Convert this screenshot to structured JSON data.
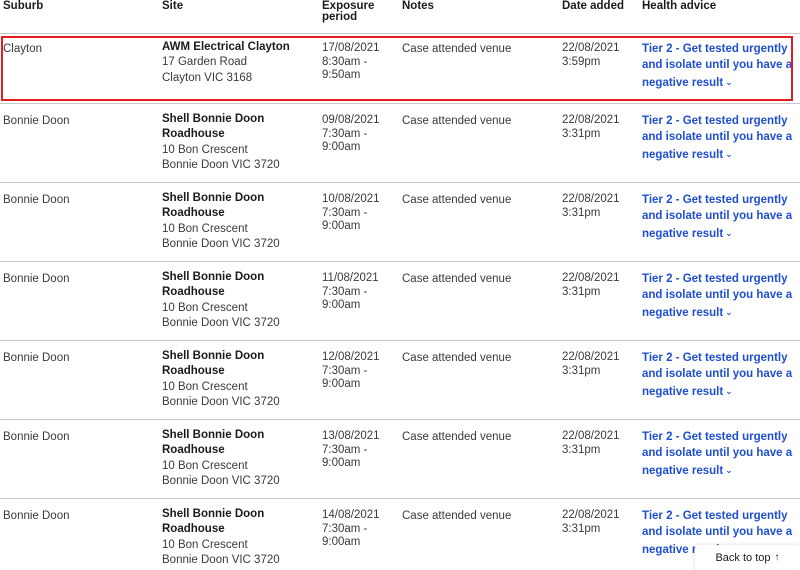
{
  "headers": {
    "suburb": "Suburb",
    "site": "Site",
    "exposure_line1": "Exposure",
    "exposure_line2": "period",
    "notes": "Notes",
    "date_added": "Date added",
    "health_advice": "Health advice"
  },
  "rows": [
    {
      "suburb": "Clayton",
      "site_name": "AWM Electrical Clayton",
      "address1": "17 Garden Road",
      "address2": "Clayton VIC 3168",
      "exp_date": "17/08/2021",
      "exp_time1": "8:30am -",
      "exp_time2": "9:50am",
      "notes": "Case attended venue",
      "date_added": "22/08/2021",
      "time_added": "3:59pm",
      "advice": "Tier 2 - Get tested urgently and isolate until you have a negative result"
    },
    {
      "suburb": "Bonnie Doon",
      "site_name": "Shell Bonnie Doon Roadhouse",
      "address1": "10 Bon Crescent",
      "address2": "Bonnie Doon VIC 3720",
      "exp_date": "09/08/2021",
      "exp_time1": "7:30am -",
      "exp_time2": "9:00am",
      "notes": "Case attended venue",
      "date_added": "22/08/2021",
      "time_added": "3:31pm",
      "advice": "Tier 2 - Get tested urgently and isolate until you have a negative result"
    },
    {
      "suburb": "Bonnie Doon",
      "site_name": "Shell Bonnie Doon Roadhouse",
      "address1": "10 Bon Crescent",
      "address2": "Bonnie Doon VIC 3720",
      "exp_date": "10/08/2021",
      "exp_time1": "7:30am -",
      "exp_time2": "9:00am",
      "notes": "Case attended venue",
      "date_added": "22/08/2021",
      "time_added": "3:31pm",
      "advice": "Tier 2 - Get tested urgently and isolate until you have a negative result"
    },
    {
      "suburb": "Bonnie Doon",
      "site_name": "Shell Bonnie Doon Roadhouse",
      "address1": "10 Bon Crescent",
      "address2": "Bonnie Doon VIC 3720",
      "exp_date": "11/08/2021",
      "exp_time1": "7:30am -",
      "exp_time2": "9:00am",
      "notes": "Case attended venue",
      "date_added": "22/08/2021",
      "time_added": "3:31pm",
      "advice": "Tier 2 - Get tested urgently and isolate until you have a negative result"
    },
    {
      "suburb": "Bonnie Doon",
      "site_name": "Shell Bonnie Doon Roadhouse",
      "address1": "10 Bon Crescent",
      "address2": "Bonnie Doon VIC 3720",
      "exp_date": "12/08/2021",
      "exp_time1": "7:30am -",
      "exp_time2": "9:00am",
      "notes": "Case attended venue",
      "date_added": "22/08/2021",
      "time_added": "3:31pm",
      "advice": "Tier 2 - Get tested urgently and isolate until you have a negative result"
    },
    {
      "suburb": "Bonnie Doon",
      "site_name": "Shell Bonnie Doon Roadhouse",
      "address1": "10 Bon Crescent",
      "address2": "Bonnie Doon VIC 3720",
      "exp_date": "13/08/2021",
      "exp_time1": "7:30am -",
      "exp_time2": "9:00am",
      "notes": "Case attended venue",
      "date_added": "22/08/2021",
      "time_added": "3:31pm",
      "advice": "Tier 2 - Get tested urgently and isolate until you have a negative result"
    },
    {
      "suburb": "Bonnie Doon",
      "site_name": "Shell Bonnie Doon Roadhouse",
      "address1": "10 Bon Crescent",
      "address2": "Bonnie Doon VIC 3720",
      "exp_date": "14/08/2021",
      "exp_time1": "7:30am -",
      "exp_time2": "9:00am",
      "notes": "Case attended venue",
      "date_added": "22/08/2021",
      "time_added": "3:31pm",
      "advice": "Tier 2 - Get tested urgently and isolate until you have a negative result"
    }
  ],
  "back_to_top": "Back to top",
  "icons": {
    "advice_chevron": "chevron-down-icon",
    "back_to_top": "arrow-up-icon"
  },
  "colors": {
    "link": "#1f4fd1",
    "highlight": "#e02020",
    "divider": "#c8c8c8"
  }
}
